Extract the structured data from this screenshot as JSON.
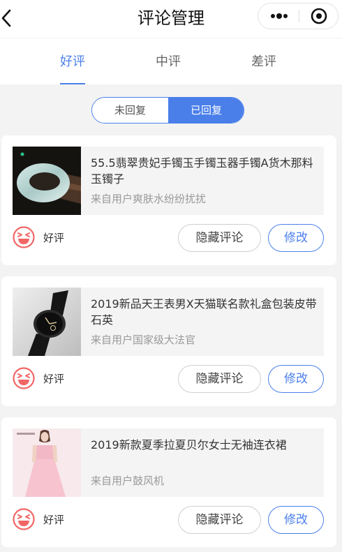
{
  "nav": {
    "title": "评论管理",
    "back_icon": "chevron-left-icon",
    "more_icon": "more-dots-icon",
    "close_icon": "target-circle-icon"
  },
  "tabs": [
    {
      "label": "好评",
      "active": true
    },
    {
      "label": "中评",
      "active": false
    },
    {
      "label": "差评",
      "active": false
    }
  ],
  "reply_filter": {
    "options": [
      "未回复",
      "已回复"
    ],
    "selected": "已回复"
  },
  "colors": {
    "accent": "#4a7fea",
    "rating_icon": "#f26666",
    "background": "#f3f3f3"
  },
  "comments": [
    {
      "product_title": "55.5翡翠贵妃手镯玉手镯玉器手镯A货木那料玉镯子",
      "from_user": "来自用户爽肤水纷纷扰扰",
      "thumbnail": "jade-bracelet-image",
      "rating_label": "好评",
      "hide_button": "隐藏评论",
      "edit_button": "修改"
    },
    {
      "product_title": "2019新品天王表男X天猫联名款礼盒包装皮带石英",
      "from_user": "来自用户国家级大法官",
      "thumbnail": "wristwatch-image",
      "rating_label": "好评",
      "hide_button": "隐藏评论",
      "edit_button": "修改"
    },
    {
      "product_title": "2019新款夏季拉夏贝尔女士无袖连衣裙",
      "from_user": "来自用户鼓风机",
      "thumbnail": "pink-dress-image",
      "rating_label": "好评",
      "hide_button": "隐藏评论",
      "edit_button": "修改"
    }
  ]
}
